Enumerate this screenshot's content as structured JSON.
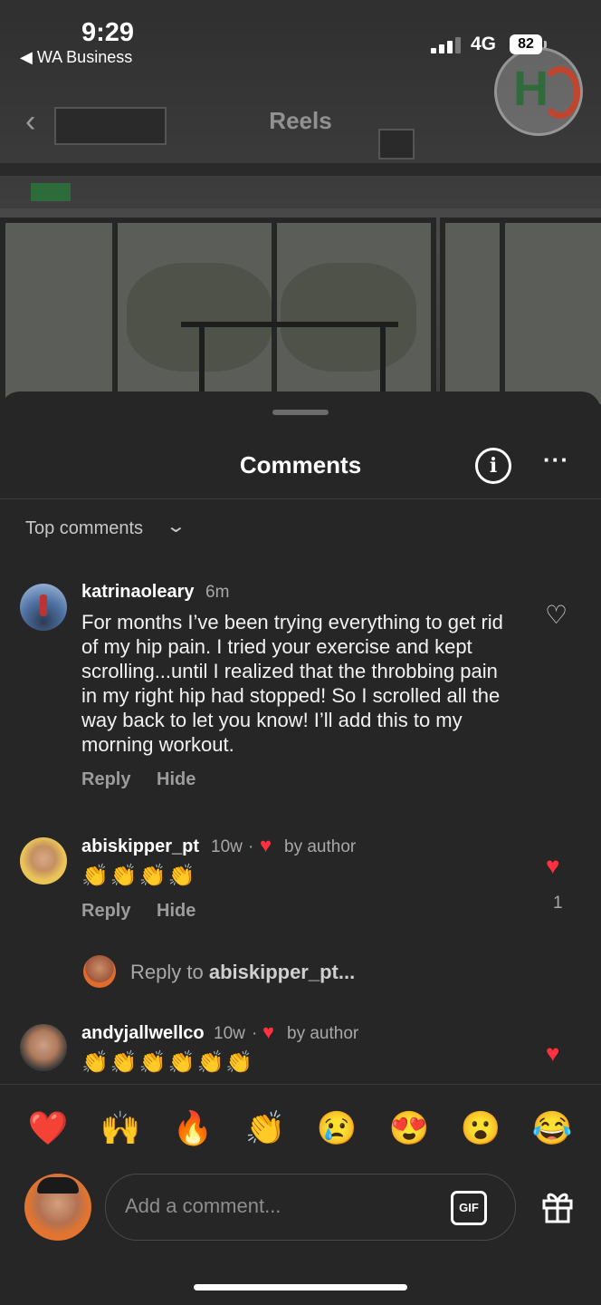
{
  "status_bar": {
    "time": "9:29",
    "back_app": "◀ WA Business",
    "network": "4G",
    "battery": "82"
  },
  "nav": {
    "title": "Reels",
    "back_icon": "chevron-left-icon"
  },
  "sheet": {
    "title": "Comments",
    "info_icon": "info-circle-icon",
    "more_icon": "more-horizontal-icon",
    "sort_label": "Top comments"
  },
  "comments": [
    {
      "username": "katrinaoleary",
      "time": "6m",
      "text": "For months I’ve been trying everything to get rid of my hip pain. I tried your exercise and kept scrolling...until I realized that the throbbing pain in my right hip had stopped! So I scrolled all the way back to let you know!  I’ll add this to my morning workout.",
      "reply_label": "Reply",
      "hide_label": "Hide",
      "liked": false
    },
    {
      "username": "abiskipper_pt",
      "time": "10w",
      "author_badge": "by author",
      "text": "👏👏👏👏",
      "reply_label": "Reply",
      "hide_label": "Hide",
      "liked": true,
      "like_count": "1"
    },
    {
      "username": "andyjallwellco",
      "time": "10w",
      "author_badge": "by author",
      "text": "👏👏👏👏👏👏",
      "liked": true
    }
  ],
  "reply_prompt": {
    "prefix": "Reply to ",
    "target": "abiskipper_pt..."
  },
  "reactions": [
    "❤️",
    "🙌",
    "🔥",
    "👏",
    "😢",
    "😍",
    "😮",
    "😂"
  ],
  "composer": {
    "placeholder": "Add a comment...",
    "gif_label": "GIF"
  },
  "colors": {
    "sheet_bg": "#262626",
    "like_red": "#ff3040"
  }
}
